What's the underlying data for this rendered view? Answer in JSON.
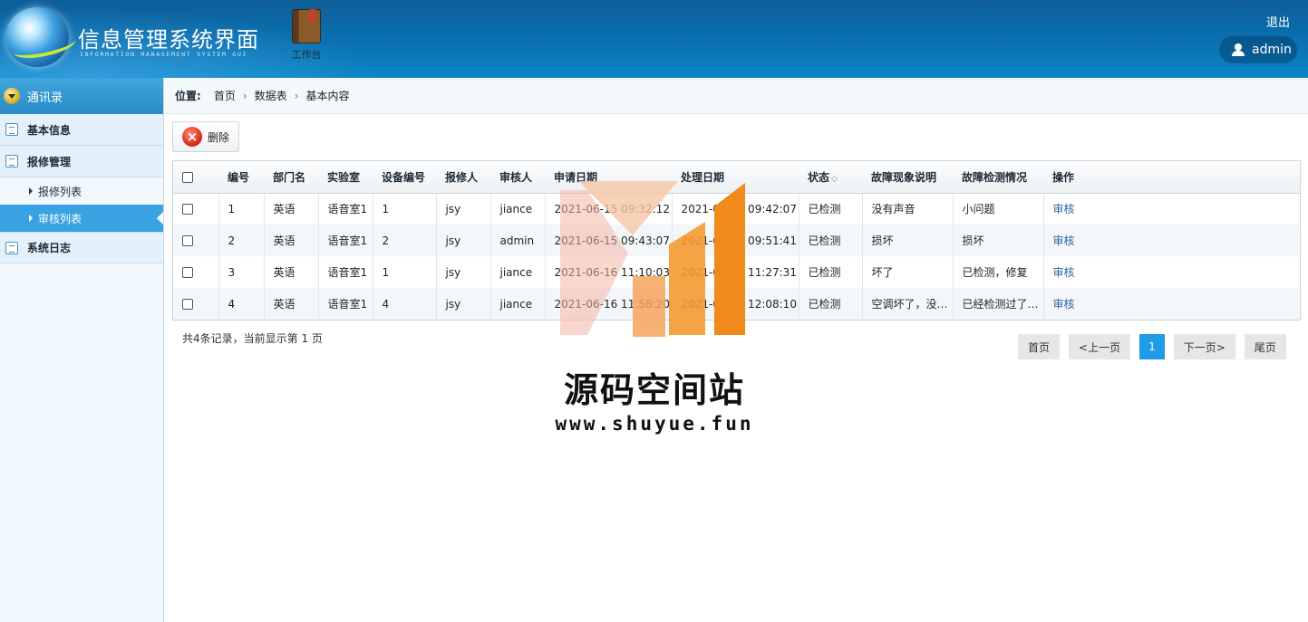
{
  "header": {
    "title": "信息管理系统界面",
    "subtitle": "INFORMATION MANAGEMENT SYSTEM GUI",
    "workbench_label": "工作台",
    "logout_label": "退出",
    "username": "admin"
  },
  "sidebar": {
    "group_title": "通讯录",
    "items": [
      {
        "label": "基本信息",
        "type": "section",
        "icon": "list-icon"
      },
      {
        "label": "报修管理",
        "type": "section",
        "icon": "edit-icon"
      },
      {
        "label": "报修列表",
        "type": "sub"
      },
      {
        "label": "审核列表",
        "type": "sub",
        "active": true
      },
      {
        "label": "系统日志",
        "type": "section",
        "icon": "comment-icon"
      }
    ]
  },
  "breadcrumb": {
    "label": "位置:",
    "items": [
      "首页",
      "数据表",
      "基本内容"
    ]
  },
  "toolbar": {
    "delete_label": "删除"
  },
  "table": {
    "headers": [
      "编号",
      "部门名",
      "实验室",
      "设备编号",
      "报修人",
      "审核人",
      "申请日期",
      "处理日期",
      "状态",
      "故障现象说明",
      "故障检测情况",
      "操作"
    ],
    "rows": [
      [
        "1",
        "英语",
        "语音室1",
        "1",
        "jsy",
        "jiance",
        "2021-06-15 09:32:12",
        "2021-06-15 09:42:07",
        "已检测",
        "没有声音",
        "小问题",
        "审核"
      ],
      [
        "2",
        "英语",
        "语音室1",
        "2",
        "jsy",
        "admin",
        "2021-06-15 09:43:07",
        "2021-06-15 09:51:41",
        "已检测",
        "损坏",
        "损坏",
        "审核"
      ],
      [
        "3",
        "英语",
        "语音室1",
        "1",
        "jsy",
        "jiance",
        "2021-06-16 11:10:03",
        "2021-06-16 11:27:31",
        "已检测",
        "坏了",
        "已检测，修复",
        "审核"
      ],
      [
        "4",
        "英语",
        "语音室1",
        "4",
        "jsy",
        "jiance",
        "2021-06-16 11:58:20",
        "2021-06-16 12:08:10",
        "已检测",
        "空调坏了，没有冷风",
        "已经检测过了，可以使用",
        "审核"
      ]
    ]
  },
  "summary": "共4条记录，当前显示第 1 页",
  "pager": {
    "first": "首页",
    "prev": "<上一页",
    "current": "1",
    "next": "下一页>",
    "last": "尾页"
  },
  "watermark": {
    "title": "源码空间站",
    "url": "www.shuyue.fun"
  },
  "colors": {
    "header": "#0b6aa8",
    "sidebar_active": "#3aa2e0",
    "pager_current": "#1f9be8",
    "link": "#2b63a5",
    "watermark_orange": "#f08a1a"
  }
}
